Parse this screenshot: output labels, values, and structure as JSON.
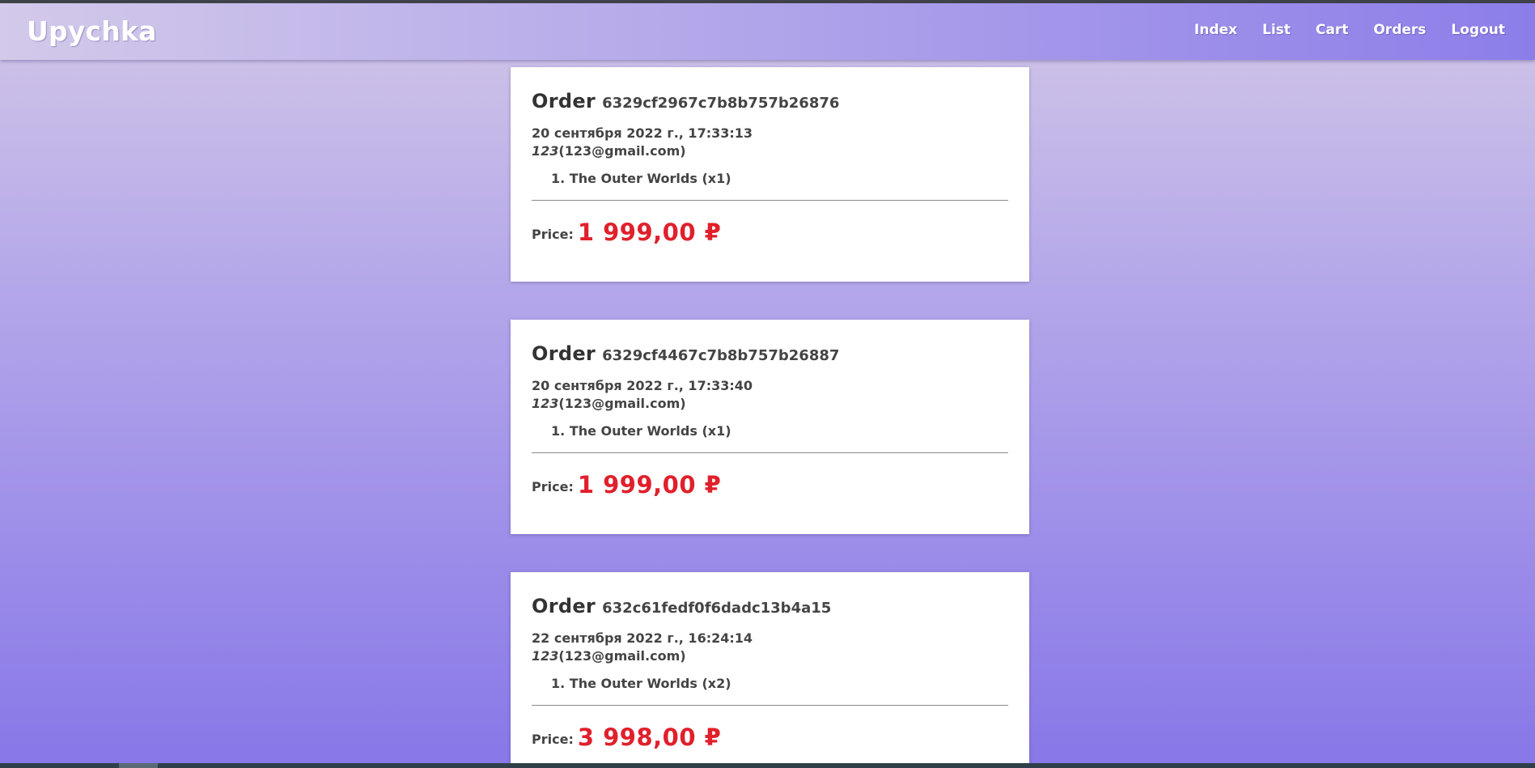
{
  "navbar": {
    "brand": "Upychka",
    "links": [
      {
        "label": "Index"
      },
      {
        "label": "List"
      },
      {
        "label": "Cart"
      },
      {
        "label": "Orders"
      },
      {
        "label": "Logout"
      }
    ]
  },
  "orders": [
    {
      "title_word": "Order",
      "id": "6329cf2967c7b8b757b26876",
      "date": "20 сентября 2022 г., 17:33:13",
      "user_name": "123",
      "user_email": "(123@gmail.com)",
      "items": [
        "1. The Outer Worlds (x1)"
      ],
      "price_label": "Price:",
      "price": "1 999,00 ₽"
    },
    {
      "title_word": "Order",
      "id": "6329cf4467c7b8b757b26887",
      "date": "20 сентября 2022 г., 17:33:40",
      "user_name": "123",
      "user_email": "(123@gmail.com)",
      "items": [
        "1. The Outer Worlds (x1)"
      ],
      "price_label": "Price:",
      "price": "1 999,00 ₽"
    },
    {
      "title_word": "Order",
      "id": "632c61fedf0f6dadc13b4a15",
      "date": "22 сентября 2022 г., 16:24:14",
      "user_name": "123",
      "user_email": "(123@gmail.com)",
      "items": [
        "1. The Outer Worlds (x2)"
      ],
      "price_label": "Price:",
      "price": "3 998,00 ₽"
    }
  ]
}
